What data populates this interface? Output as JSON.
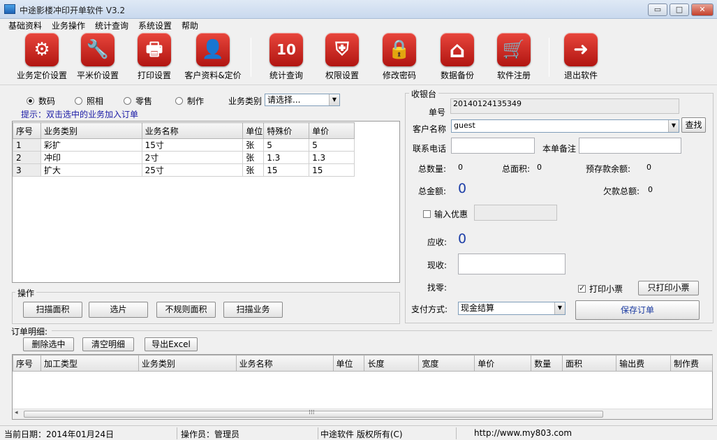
{
  "window": {
    "title": "中途影楼冲印开单软件 V3.2",
    "min": "▭",
    "max": "□",
    "close": "✕"
  },
  "menu": [
    "基础资料",
    "业务操作",
    "统计查询",
    "系统设置",
    "帮助"
  ],
  "toolbar": [
    {
      "label": "业务定价设置",
      "icon": "gear-icon",
      "glyph": "⚙"
    },
    {
      "label": "平米价设置",
      "icon": "wrench-icon",
      "glyph": "🔧"
    },
    {
      "label": "打印设置",
      "icon": "printer-icon",
      "glyph": "🖶"
    },
    {
      "label": "客户资料&定价",
      "icon": "user-icon",
      "glyph": "👤"
    },
    {
      "label": "统计查询",
      "icon": "calendar-icon",
      "glyph": "10"
    },
    {
      "label": "权限设置",
      "icon": "shield-icon",
      "glyph": "⛨"
    },
    {
      "label": "修改密码",
      "icon": "lock-icon",
      "glyph": "🔒"
    },
    {
      "label": "数据备份",
      "icon": "home-icon",
      "glyph": "⌂"
    },
    {
      "label": "软件注册",
      "icon": "cart-icon",
      "glyph": "🛒"
    },
    {
      "label": "退出软件",
      "icon": "exit-arrow-icon",
      "glyph": "➜"
    }
  ],
  "business": {
    "radios": [
      {
        "label": "数码",
        "selected": true
      },
      {
        "label": "照相",
        "selected": false
      },
      {
        "label": "零售",
        "selected": false
      },
      {
        "label": "制作",
        "selected": false
      }
    ],
    "category_label": "业务类别",
    "category_value": "请选择...",
    "hint": "提示：双击选中的业务加入订单",
    "columns": [
      "序号",
      "业务类别",
      "业务名称",
      "单位",
      "特殊价",
      "单价"
    ],
    "rows": [
      [
        "1",
        "彩扩",
        "15寸",
        "张",
        "5",
        "5"
      ],
      [
        "2",
        "冲印",
        "2寸",
        "张",
        "1.3",
        "1.3"
      ],
      [
        "3",
        "扩大",
        "25寸",
        "张",
        "15",
        "15"
      ]
    ]
  },
  "operations": {
    "legend": "操作",
    "buttons": [
      "扫描面积",
      "选片",
      "不规则面积",
      "扫描业务"
    ]
  },
  "cashier": {
    "legend": "收银台",
    "order_no_label": "单号",
    "order_no": "20140124135349",
    "customer_label": "客户名称",
    "customer": "guest",
    "search_button": "查找",
    "phone_label": "联系电话",
    "phone": "",
    "remark_label": "本单备注",
    "remark": "",
    "total_qty_label": "总数量:",
    "total_qty": "0",
    "total_area_label": "总面积:",
    "total_area": "0",
    "prepay_label": "预存款余额:",
    "prepay": "0",
    "total_amount_label": "总金额:",
    "total_amount": "0",
    "owed_label": "欠款总额:",
    "owed": "0",
    "discount_label": "输入优惠",
    "receivable_label": "应收:",
    "receivable": "0",
    "received_label": "现收:",
    "change_label": "找零:",
    "print_ticket_label": "打印小票",
    "print_only_button": "只打印小票",
    "pay_method_label": "支付方式:",
    "pay_method": "现金结算",
    "save_button": "保存订单"
  },
  "order_detail": {
    "legend": "订单明细:",
    "buttons": [
      "删除选中",
      "清空明细",
      "导出Excel"
    ],
    "columns": [
      "序号",
      "加工类型",
      "业务类别",
      "业务名称",
      "单位",
      "长度",
      "宽度",
      "单价",
      "数量",
      "面积",
      "输出费",
      "制作费"
    ],
    "scroll_grip": "⁞⁞⁞"
  },
  "status": {
    "date": "当前日期：2014年01月24日",
    "operator": "操作员：管理员",
    "copyright": "中途软件 版权所有(C)",
    "url": "http://www.my803.com"
  }
}
